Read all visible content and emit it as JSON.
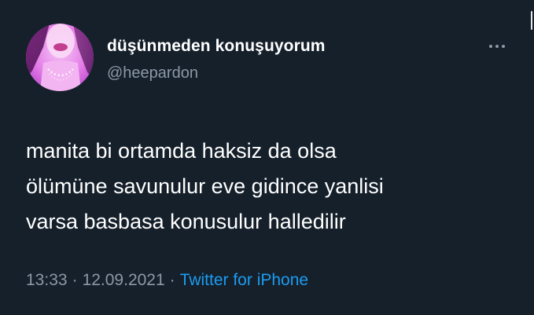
{
  "user": {
    "display_name": "düşünmeden konuşuyorum",
    "handle": "@heepardon"
  },
  "tweet": {
    "lines": [
      "manita bi ortamda haksiz da olsa",
      "ölümüne savunulur eve gidince yanlisi",
      "varsa basbasa konusulur halledilir"
    ]
  },
  "meta": {
    "time": "13:33",
    "date": "12.09.2021",
    "separator": "·",
    "source": "Twitter for iPhone"
  },
  "icons": {
    "more": "more-options-icon",
    "avatar": "profile-avatar"
  },
  "colors": {
    "background": "#15202b",
    "text": "#ffffff",
    "secondary_text": "#8b98a5",
    "link": "#1d9bf0"
  }
}
